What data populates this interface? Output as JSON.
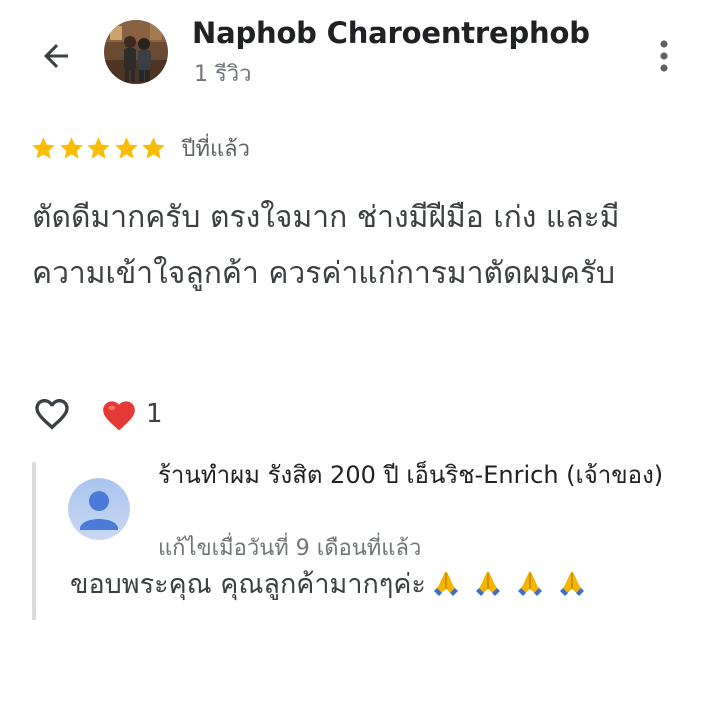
{
  "header": {
    "reviewer_name": "Naphob Charoentrephob",
    "review_count": "1 รีวิว",
    "back_icon": "arrow-back-icon",
    "more_icon": "more-vert-icon"
  },
  "review": {
    "rating": 5,
    "max_rating": 5,
    "date": "ปีที่แล้ว",
    "text": "ตัดดีมากครับ ตรงใจมาก ช่างมีฝีมือ เก่ง และมีความเข้าใจลูกค้า ควรค่าแก่การมาตัดผมครับ",
    "star_color": "#fbbc04"
  },
  "actions": {
    "like_icon": "heart-outline-icon",
    "reaction_icon": "red-heart-icon",
    "reaction_count": "1",
    "heart_color": "#e53935"
  },
  "owner_reply": {
    "name": "ร้านทำผม รังสิต 200 ปี เอ็นริช-Enrich (เจ้าของ)",
    "time": "แก้ไขเมื่อวันที่ 9 เดือนที่แล้ว",
    "text": "ขอบพระคุณ คุณลูกค้ามากๆค่ะ",
    "emojis": [
      "folded-hands-icon",
      "folded-hands-icon",
      "folded-hands-icon",
      "folded-hands-icon"
    ],
    "avatar_color": "#4a7bd8"
  }
}
